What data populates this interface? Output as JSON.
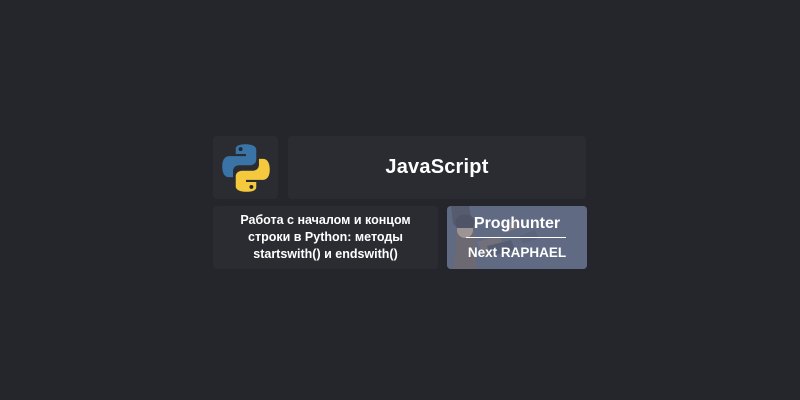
{
  "logo": {
    "icon": "python-logo-icon",
    "colors": {
      "blue": "#3a73a5",
      "yellow": "#f4c93e"
    }
  },
  "title_card": {
    "label": "JavaScript"
  },
  "article_card": {
    "title": "Работа с началом и концом строки в Python: методы startswith() и endswith()"
  },
  "promo_card": {
    "brand": "Proghunter",
    "subtitle": "Next RAPHAEL"
  },
  "colors": {
    "background": "#25262b",
    "tile": "#2b2c31",
    "text": "#ffffff"
  }
}
